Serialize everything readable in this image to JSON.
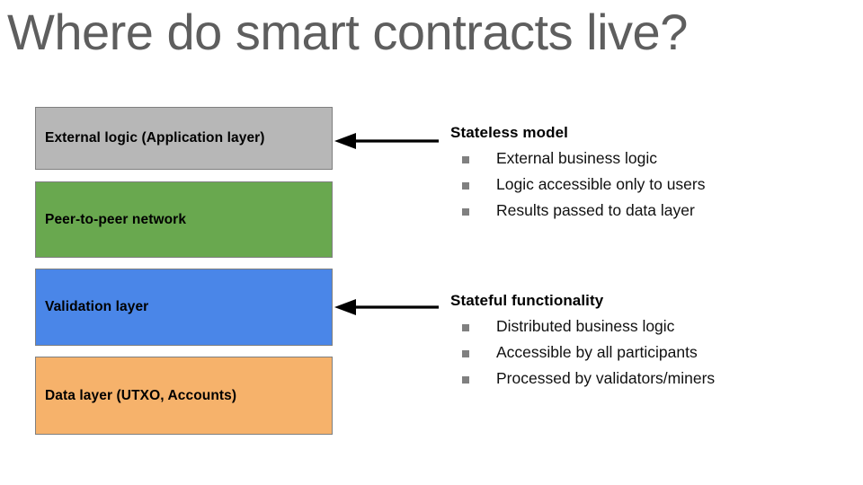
{
  "slide": {
    "title": "Where do smart contracts live?",
    "title_color": "#5e5e5e",
    "background_color": "#ffffff"
  },
  "stack": {
    "name": "blockchain-layer-stack",
    "boxes": [
      {
        "id": "application",
        "label": "External logic (Application layer)",
        "fill": "#b7b7b7",
        "border": "#7f7f7f"
      },
      {
        "id": "p2p",
        "label": "Peer-to-peer network",
        "fill": "#69a84f",
        "border": "#7f7f7f"
      },
      {
        "id": "validation",
        "label": "Validation layer",
        "fill": "#4a86e8",
        "border": "#7f7f7f"
      },
      {
        "id": "data",
        "label": "Data layer (UTXO, Accounts)",
        "fill": "#f6b26b",
        "border": "#7f7f7f"
      }
    ]
  },
  "connectors": [
    {
      "id": "arrow-application",
      "icon": "left-arrow-icon",
      "color": "#000000",
      "from": "Stateless model",
      "to": "External logic (Application layer)"
    },
    {
      "id": "arrow-validation",
      "icon": "left-arrow-icon",
      "color": "#000000",
      "from": "Stateful functionality",
      "to": "Validation layer"
    }
  ],
  "notes": [
    {
      "id": "stateless",
      "heading": "Stateless model",
      "bullet_color": "#808080",
      "items": [
        "External business logic",
        "Logic accessible only to users",
        "Results passed to data layer"
      ]
    },
    {
      "id": "stateful",
      "heading": "Stateful functionality",
      "bullet_color": "#808080",
      "items": [
        "Distributed business logic",
        "Accessible by all participants",
        "Processed by validators/miners"
      ]
    }
  ]
}
